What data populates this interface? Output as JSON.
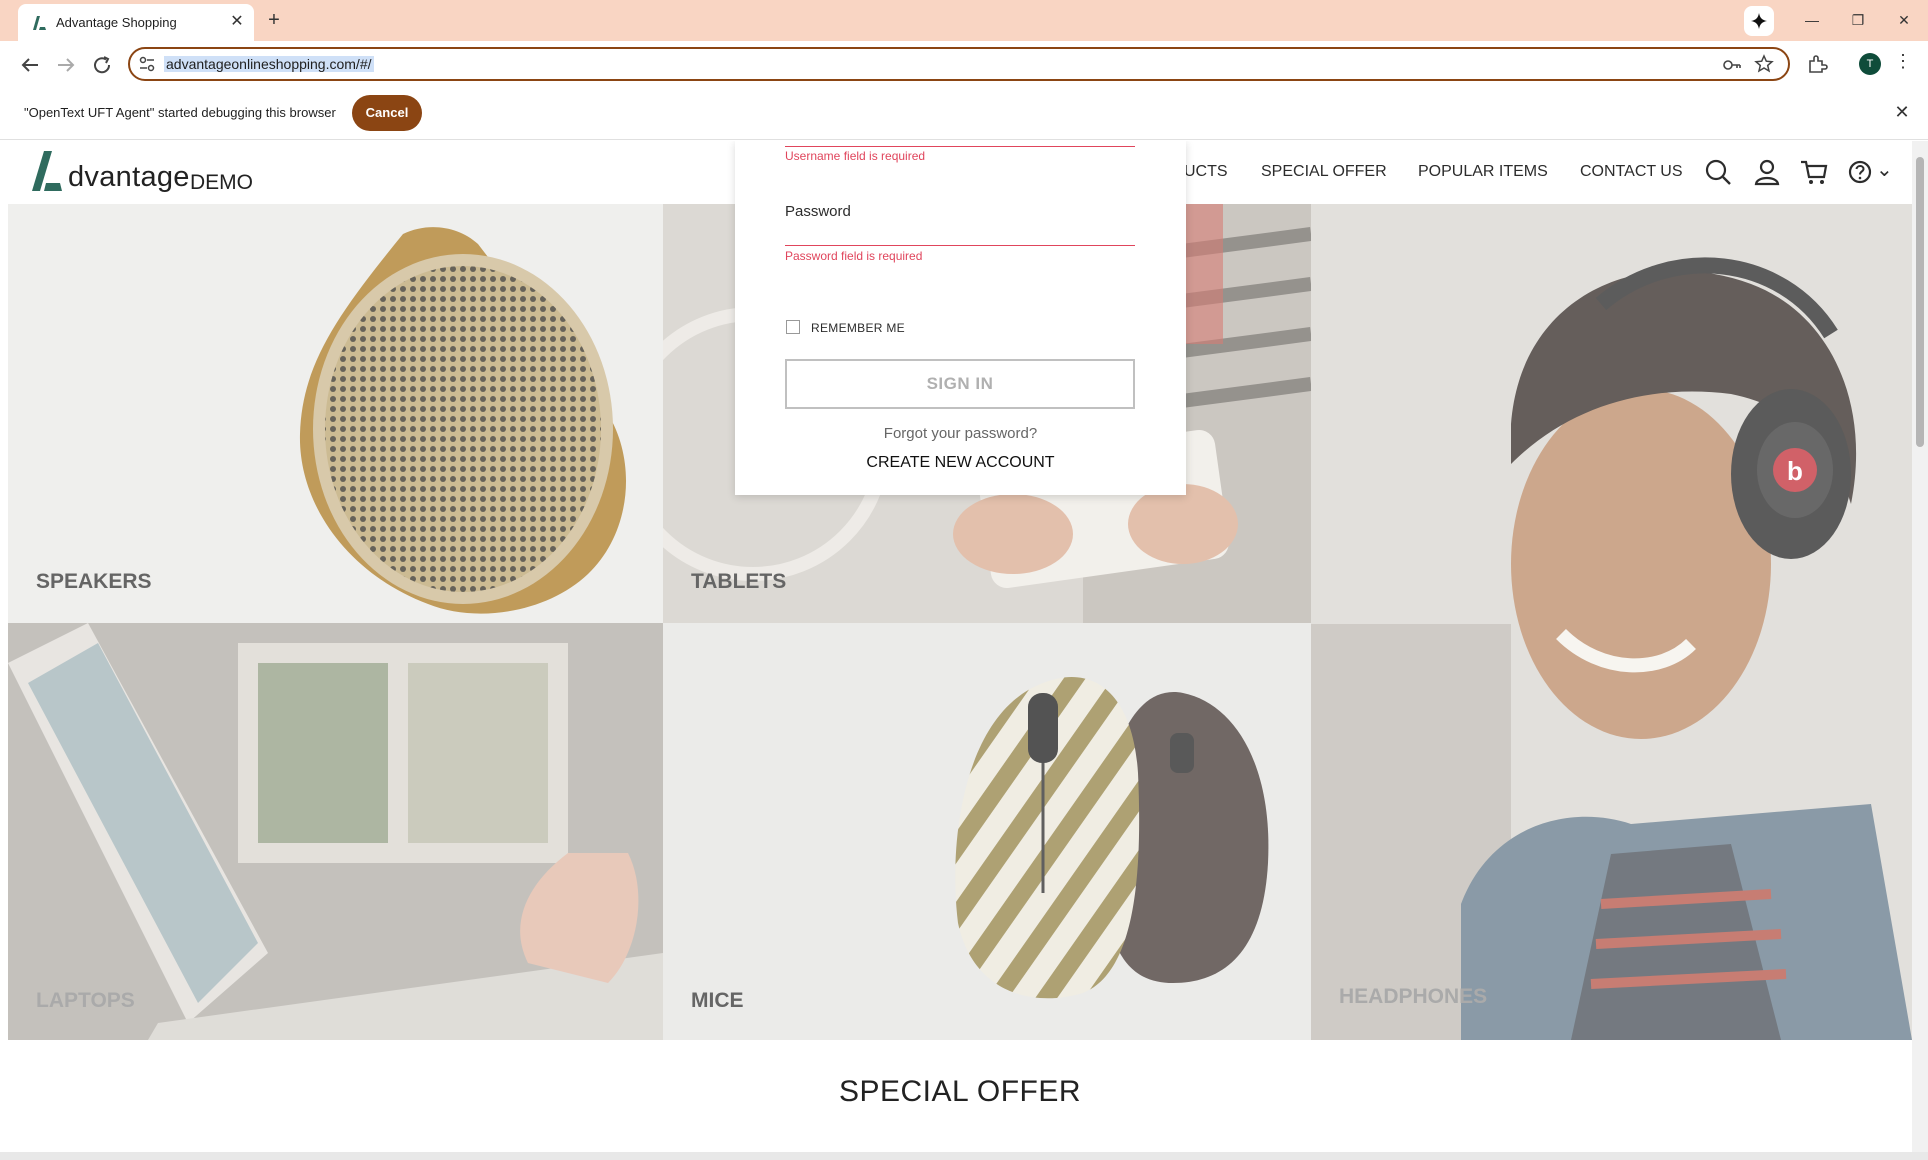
{
  "browser": {
    "tab_title": "Advantage Shopping",
    "tab_close": "✕",
    "new_tab": "+",
    "url": "advantageonlineshopping.com/#/",
    "profile_initial": "T",
    "window_controls": {
      "minimize": "—",
      "restore": "❐",
      "close": "✕"
    }
  },
  "infobar": {
    "message": "\"OpenText UFT Agent\" started debugging this browser",
    "cancel_label": "Cancel",
    "close": "✕"
  },
  "site": {
    "logo_word": "dvantage",
    "logo_demo": "DEMO",
    "nav": [
      "UCTS",
      "SPECIAL OFFER",
      "POPULAR ITEMS",
      "CONTACT US"
    ],
    "help_caret": "⌄"
  },
  "categories": {
    "speakers": "SPEAKERS",
    "tablets": "TABLETS",
    "headphones": "HEADPHONES",
    "laptops": "LAPTOPS",
    "mice": "MICE"
  },
  "special_offer_title": "SPECIAL OFFER",
  "login": {
    "username_error": "Username field is required",
    "password_label": "Password",
    "password_error": "Password field is required",
    "remember_label": "REMEMBER ME",
    "signin_label": "SIGN IN",
    "forgot_label": "Forgot your password?",
    "create_label": "CREATE NEW ACCOUNT"
  },
  "colors": {
    "chrome_tabbar": "#f9d5c3",
    "accent_brown": "#8b4513",
    "error_red": "#e0455c",
    "logo_teal": "#2f6b5e"
  }
}
